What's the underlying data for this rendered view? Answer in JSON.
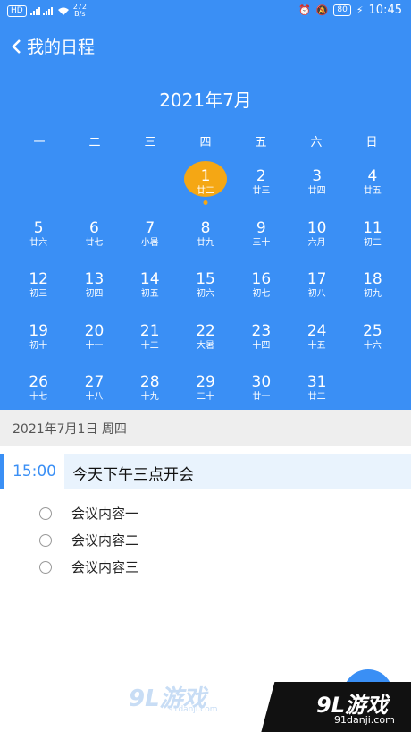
{
  "status": {
    "network": "HD",
    "speed_top": "272",
    "speed_bottom": "B/s",
    "battery": "80",
    "time": "10:45"
  },
  "header": {
    "title": "我的日程"
  },
  "calendar": {
    "month_title": "2021年7月",
    "weekdays": [
      "一",
      "二",
      "三",
      "四",
      "五",
      "六",
      "日"
    ],
    "days": [
      {
        "n": "",
        "l": ""
      },
      {
        "n": "",
        "l": ""
      },
      {
        "n": "",
        "l": ""
      },
      {
        "n": "1",
        "l": "廿二",
        "selected": true
      },
      {
        "n": "2",
        "l": "廿三"
      },
      {
        "n": "3",
        "l": "廿四"
      },
      {
        "n": "4",
        "l": "廿五"
      },
      {
        "n": "5",
        "l": "廿六"
      },
      {
        "n": "6",
        "l": "廿七"
      },
      {
        "n": "7",
        "l": "小暑"
      },
      {
        "n": "8",
        "l": "廿九"
      },
      {
        "n": "9",
        "l": "三十"
      },
      {
        "n": "10",
        "l": "六月"
      },
      {
        "n": "11",
        "l": "初二"
      },
      {
        "n": "12",
        "l": "初三"
      },
      {
        "n": "13",
        "l": "初四"
      },
      {
        "n": "14",
        "l": "初五"
      },
      {
        "n": "15",
        "l": "初六"
      },
      {
        "n": "16",
        "l": "初七"
      },
      {
        "n": "17",
        "l": "初八"
      },
      {
        "n": "18",
        "l": "初九"
      },
      {
        "n": "19",
        "l": "初十"
      },
      {
        "n": "20",
        "l": "十一"
      },
      {
        "n": "21",
        "l": "十二"
      },
      {
        "n": "22",
        "l": "大暑"
      },
      {
        "n": "23",
        "l": "十四"
      },
      {
        "n": "24",
        "l": "十五"
      },
      {
        "n": "25",
        "l": "十六"
      },
      {
        "n": "26",
        "l": "十七"
      },
      {
        "n": "27",
        "l": "十八"
      },
      {
        "n": "28",
        "l": "十九"
      },
      {
        "n": "29",
        "l": "二十"
      },
      {
        "n": "30",
        "l": "廿一"
      },
      {
        "n": "31",
        "l": "廿二"
      }
    ]
  },
  "selected_date": "2021年7月1日 周四",
  "event": {
    "time": "15:00",
    "title": "今天下午三点开会"
  },
  "tasks": [
    "会议内容一",
    "会议内容二",
    "会议内容三"
  ],
  "watermark": {
    "logo": "9L游戏",
    "site": "91danji.com"
  },
  "colors": {
    "primary": "#3a8ff5",
    "selected": "#f5a714"
  }
}
